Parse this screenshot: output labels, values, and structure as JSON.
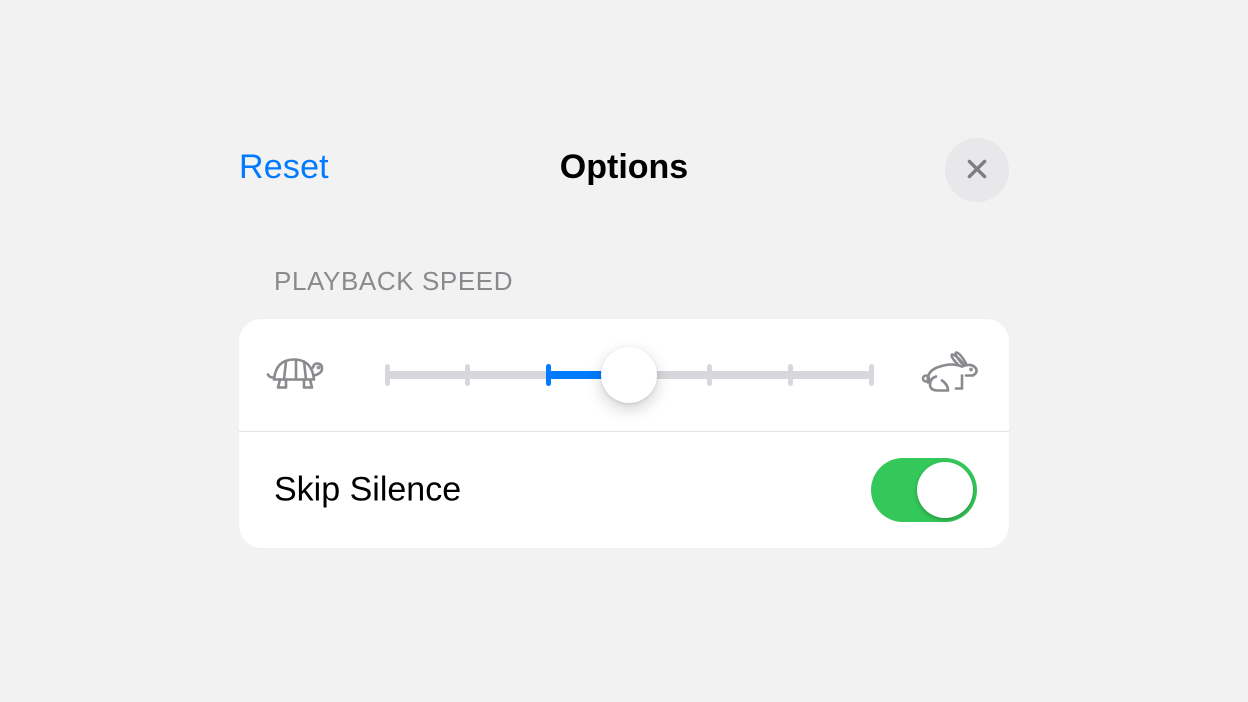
{
  "header": {
    "reset_label": "Reset",
    "title": "Options"
  },
  "playback": {
    "section_label": "PLAYBACK SPEED",
    "slider": {
      "ticks": 7,
      "default_index": 2,
      "value_index": 3
    }
  },
  "skip_silence": {
    "label": "Skip Silence",
    "enabled": true
  },
  "colors": {
    "accent": "#007aff",
    "toggle_on": "#34c759"
  }
}
